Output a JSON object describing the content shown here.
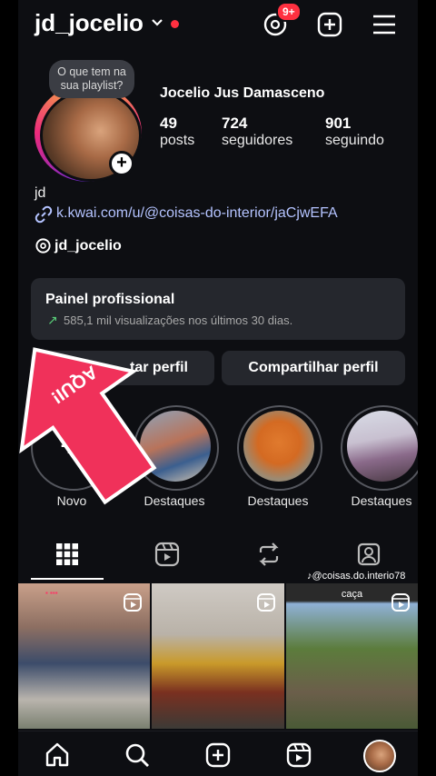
{
  "header": {
    "username": "jd_jocelio",
    "notifications_badge": "9+"
  },
  "profile": {
    "note": "O que tem na sua playlist?",
    "full_name": "Jocelio Jus Damasceno",
    "stats": [
      {
        "value": "49",
        "label": "posts"
      },
      {
        "value": "724",
        "label": "seguidores"
      },
      {
        "value": "901",
        "label": "seguindo"
      }
    ],
    "bio": "jd",
    "link": "k.kwai.com/u/@coisas-do-interior/jaCjwEFA",
    "threads_handle": "jd_jocelio"
  },
  "panel": {
    "title": "Painel profissional",
    "subtitle": "585,1 mil visualizações nos últimos 30 dias."
  },
  "buttons": {
    "edit_profile": "tar perfil",
    "share_profile": "Compartilhar perfil"
  },
  "overlay": {
    "arrow_text": "AQUI!"
  },
  "highlights": [
    {
      "label": "Novo"
    },
    {
      "label": "Destaques"
    },
    {
      "label": "Destaques"
    },
    {
      "label": "Destaques"
    }
  ],
  "watermark": "@coisas.do.interio78",
  "grid": {
    "cell3_caption": "caça"
  },
  "colors": {
    "accent_red": "#ff3040",
    "link_blue": "#b4c3ff",
    "arrow_pink": "#f0315a",
    "panel_bg": "#25272d"
  }
}
